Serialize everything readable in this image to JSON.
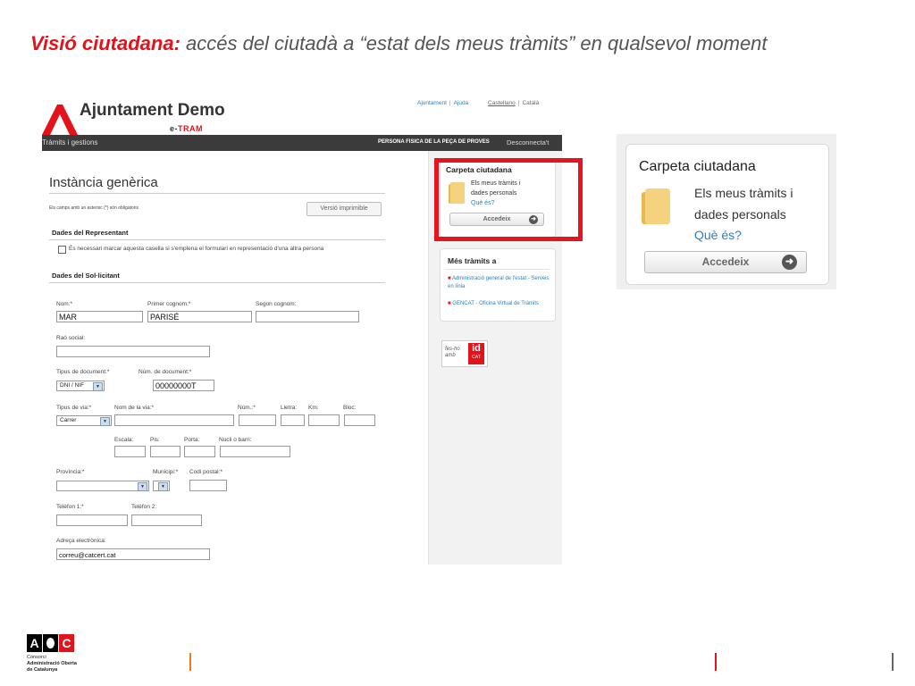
{
  "slide": {
    "title_bold": "Visió ciutadana:",
    "title_rest": " accés del ciutadà a “estat dels meus tràmits” en qualsevol moment"
  },
  "header": {
    "brand": "Ajuntament Demo",
    "sub_e": "e-",
    "sub_tram": "TRAM",
    "links": [
      "Ajuntament",
      "Ajuda",
      "Castellano",
      "Català"
    ]
  },
  "navbar": {
    "left": "Tràmits i gestions",
    "user": "PERSONA FISICA DE LA PEÇA DE PROVES",
    "logout": "Desconnecta't"
  },
  "form": {
    "title": "Instància genèrica",
    "required_note": "Els camps amb un asterisc (*) són obligatoris",
    "print_button": "Versió imprimible",
    "section_rep": "Dades del Representant",
    "checkbox_label": "És necessari marcar aquesta casella si s'emplena el formulari en representació d'una altra persona",
    "section_sol": "Dades del Sol·licitant",
    "labels": {
      "nom": "Nom:*",
      "cognom1": "Primer cognom:*",
      "cognom2": "Segon cognom:",
      "rao": "Raó social:",
      "tipus_doc": "Tipus de document:*",
      "num_doc": "Núm. de document:*",
      "tipus_via": "Tipus de via:*",
      "nom_via": "Nom de la via:*",
      "num": "Núm.:*",
      "lletra": "Lletra:",
      "km": "Km:",
      "bloc": "Bloc:",
      "escala": "Escala:",
      "pis": "Pis:",
      "porta": "Porta:",
      "nucli": "Nucli o barri:",
      "provincia": "Província:*",
      "municipi": "Municipi:*",
      "codi_postal": "Codi postal:*",
      "tel1": "Telèfon 1:*",
      "tel2": "Telèfon 2:",
      "email": "Adreça electrònica:"
    },
    "values": {
      "nom": "MAR",
      "cognom1": "PARISÉ",
      "cognom2": "",
      "tipus_doc": "DNI / NIF",
      "num_doc": "00000000T",
      "tipus_via": "Carrer",
      "email": "correu@catcert.cat"
    }
  },
  "sidebar": {
    "carpeta": {
      "title": "Carpeta ciutadana",
      "line1": "Els meus tràmits i",
      "line2": "dades personals",
      "link": "Què és?",
      "button": "Accedeix"
    },
    "mes": {
      "title": "Més tràmits a",
      "items": [
        "Administració general de l'estat - Serveis en línia",
        "GENCAT - Oficina Virtual de Tràmits"
      ]
    },
    "badge_text": "fes-ho amb",
    "badge_id": "id",
    "badge_cat": "CAT"
  },
  "zoom": {
    "title": "Carpeta ciutadana",
    "line1": "Els meus tràmits i",
    "line2": "dades personals",
    "link": "Què és?",
    "button": "Accedeix"
  },
  "footer": {
    "logo_a": "A",
    "logo_c": "C",
    "line1": "Consorci",
    "line2": "Administració Oberta",
    "line3": "de Catalunya"
  },
  "colors": {
    "accent": "#e3121b",
    "link": "#2a7fbf",
    "navbar": "#3b3b3b",
    "folder": "#f2c96b"
  }
}
